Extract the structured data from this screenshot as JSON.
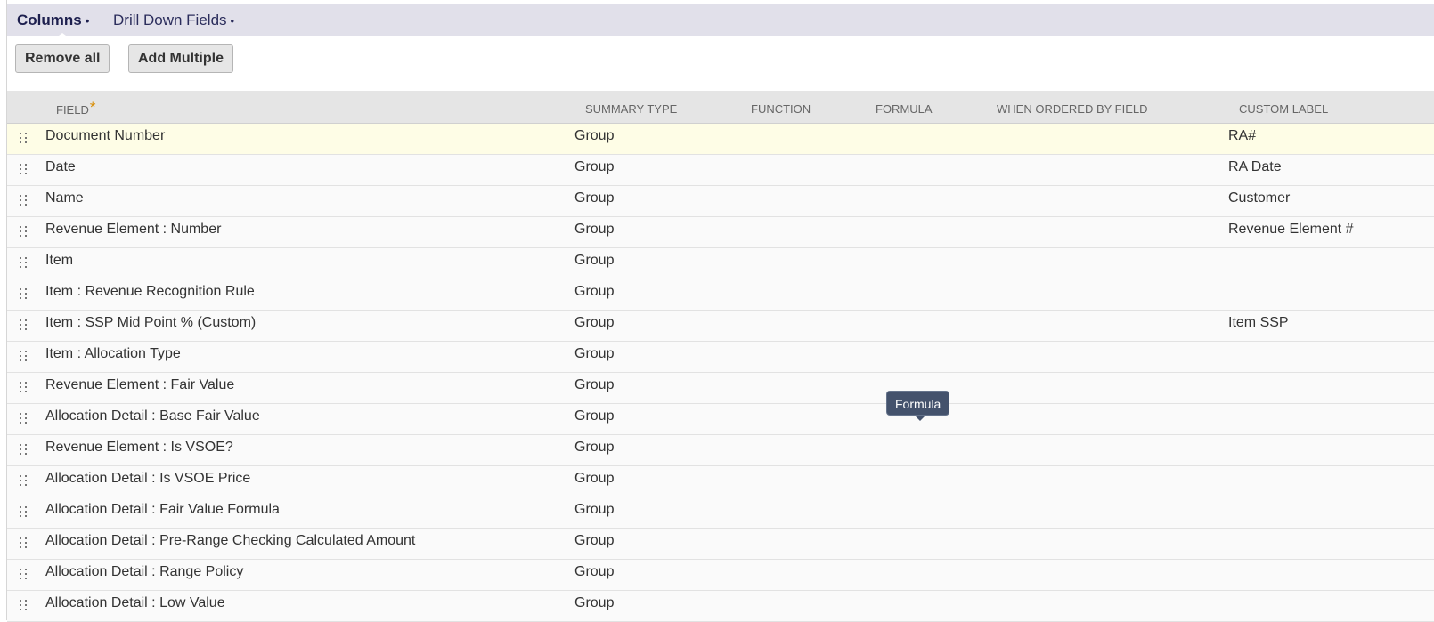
{
  "tabs": [
    {
      "label": "Columns",
      "dot": "•"
    },
    {
      "label": "Drill Down Fields",
      "dot": "•"
    }
  ],
  "toolbar": {
    "remove_all_label": "Remove all",
    "add_multiple_label": "Add Multiple"
  },
  "table": {
    "headers": {
      "field": "FIELD",
      "field_required_marker": "*",
      "summary_type": "SUMMARY TYPE",
      "function": "FUNCTION",
      "formula": "FORMULA",
      "when_ordered_by_field": "WHEN ORDERED BY FIELD",
      "custom_label": "CUSTOM LABEL"
    },
    "rows": [
      {
        "field": "Document Number",
        "summary_type": "Group",
        "function": "",
        "formula": "",
        "when_ordered_by_field": "",
        "custom_label": "RA#"
      },
      {
        "field": "Date",
        "summary_type": "Group",
        "function": "",
        "formula": "",
        "when_ordered_by_field": "",
        "custom_label": "RA Date"
      },
      {
        "field": "Name",
        "summary_type": "Group",
        "function": "",
        "formula": "",
        "when_ordered_by_field": "",
        "custom_label": "Customer"
      },
      {
        "field": "Revenue Element : Number",
        "summary_type": "Group",
        "function": "",
        "formula": "",
        "when_ordered_by_field": "",
        "custom_label": "Revenue Element #"
      },
      {
        "field": "Item",
        "summary_type": "Group",
        "function": "",
        "formula": "",
        "when_ordered_by_field": "",
        "custom_label": ""
      },
      {
        "field": "Item : Revenue Recognition Rule",
        "summary_type": "Group",
        "function": "",
        "formula": "",
        "when_ordered_by_field": "",
        "custom_label": ""
      },
      {
        "field": "Item : SSP Mid Point % (Custom)",
        "summary_type": "Group",
        "function": "",
        "formula": "",
        "when_ordered_by_field": "",
        "custom_label": "Item SSP"
      },
      {
        "field": "Item : Allocation Type",
        "summary_type": "Group",
        "function": "",
        "formula": "",
        "when_ordered_by_field": "",
        "custom_label": ""
      },
      {
        "field": "Revenue Element : Fair Value",
        "summary_type": "Group",
        "function": "",
        "formula": "",
        "when_ordered_by_field": "",
        "custom_label": ""
      },
      {
        "field": "Allocation Detail : Base Fair Value",
        "summary_type": "Group",
        "function": "",
        "formula": "",
        "when_ordered_by_field": "",
        "custom_label": ""
      },
      {
        "field": "Revenue Element : Is VSOE?",
        "summary_type": "Group",
        "function": "",
        "formula": "",
        "when_ordered_by_field": "",
        "custom_label": ""
      },
      {
        "field": "Allocation Detail : Is VSOE Price",
        "summary_type": "Group",
        "function": "",
        "formula": "",
        "when_ordered_by_field": "",
        "custom_label": ""
      },
      {
        "field": "Allocation Detail : Fair Value Formula",
        "summary_type": "Group",
        "function": "",
        "formula": "",
        "when_ordered_by_field": "",
        "custom_label": ""
      },
      {
        "field": "Allocation Detail : Pre-Range Checking Calculated Amount",
        "summary_type": "Group",
        "function": "",
        "formula": "",
        "when_ordered_by_field": "",
        "custom_label": ""
      },
      {
        "field": "Allocation Detail : Range Policy",
        "summary_type": "Group",
        "function": "",
        "formula": "",
        "when_ordered_by_field": "",
        "custom_label": ""
      },
      {
        "field": "Allocation Detail : Low Value",
        "summary_type": "Group",
        "function": "",
        "formula": "",
        "when_ordered_by_field": "",
        "custom_label": ""
      }
    ]
  },
  "tooltip": {
    "text": "Formula"
  },
  "colors": {
    "tabbar_bg": "#e1e0ea",
    "header_bg": "#e5e5e5",
    "highlight_row_bg": "#fefde6",
    "required_marker": "#d98c00",
    "tooltip_bg": "#44526c"
  },
  "icons": {
    "row_handle": "drag-handle-icon"
  }
}
